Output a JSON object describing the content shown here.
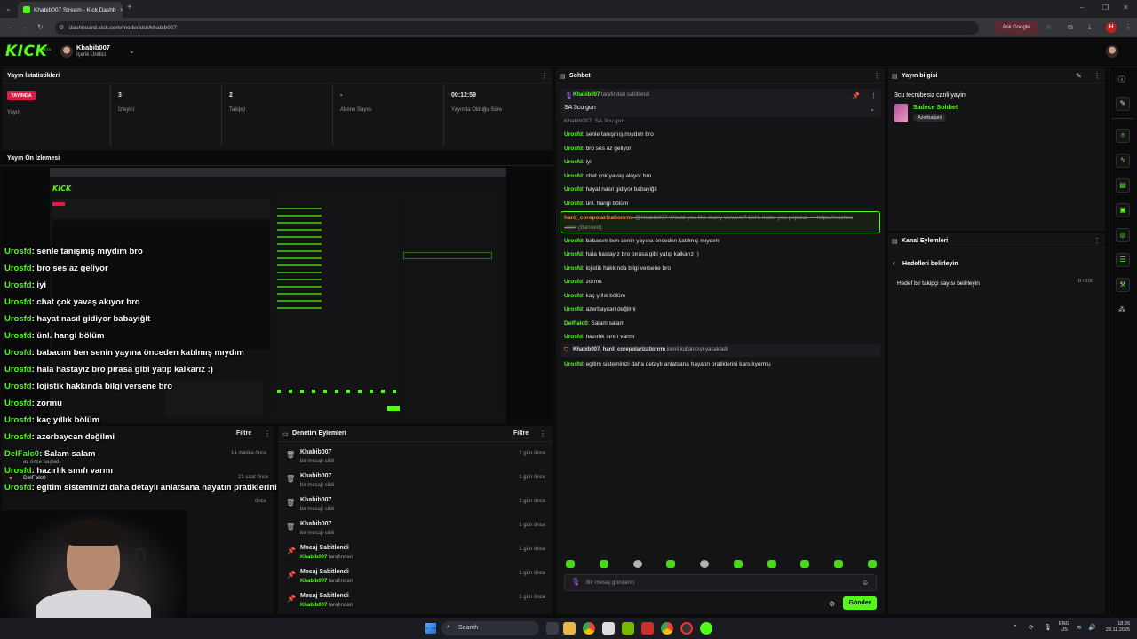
{
  "browser": {
    "tab_title": "Khabib007 Stream - Kick Dashb",
    "url": "dashboard.kick.com/moderator/khabib007",
    "ask_google": "Ask Google",
    "profile_letter": "H"
  },
  "header": {
    "logo": "KICK",
    "logo_badge": "BETA",
    "username": "Khabib007",
    "role": "İçerik Üretici"
  },
  "stats": {
    "title": "Yayın İstatistikleri",
    "live_badge": "YAYINDA",
    "items": [
      {
        "value": "",
        "label": "Yayın"
      },
      {
        "value": "3",
        "label": "İzleyici"
      },
      {
        "value": "2",
        "label": "Takipçi"
      },
      {
        "value": "-",
        "label": "Abone Sayısı"
      },
      {
        "value": "00:12:59",
        "label": "Yayında Olduğu Süre"
      }
    ]
  },
  "preview": {
    "title": "Yayın Ön İzlemesi",
    "overlay_chat": [
      {
        "user": "Urosfd",
        "msg": ": senle tanışmış mıydım bro"
      },
      {
        "user": "Urosfd",
        "msg": ": bro ses az geliyor"
      },
      {
        "user": "Urosfd",
        "msg": ": iyi"
      },
      {
        "user": "Urosfd",
        "msg": ": chat çok yavaş akıyor bro"
      },
      {
        "user": "Urosfd",
        "msg": ": hayat nasıl gidiyor babayiğit"
      },
      {
        "user": "Urosfd",
        "msg": ": ünl. hangi bölüm"
      },
      {
        "user": "Urosfd",
        "msg": ": babacım ben senin yayına önceden katılmış mıydım"
      },
      {
        "user": "Urosfd",
        "msg": ": hala hastayız bro pırasa gibi yatıp kalkarız :)"
      },
      {
        "user": "Urosfd",
        "msg": ": lojistik hakkında bilgi versene bro"
      },
      {
        "user": "Urosfd",
        "msg": ": zormu"
      },
      {
        "user": "Urosfd",
        "msg": ": kaç yıllık bölüm"
      },
      {
        "user": "Urosfd",
        "msg": ": azerbaycan değilmi"
      },
      {
        "user": "DelFalc0",
        "msg": ": Salam salam"
      },
      {
        "user": "Urosfd",
        "msg": ": hazırlık sınıfı varmı"
      },
      {
        "user": "Urosfd",
        "msg": ": egitim sisteminizi daha detaylı anlatsana hayatın pratiklerini karsılıyormu"
      }
    ]
  },
  "left_lower": {
    "filter": "Filtre",
    "row1_time": "14 dakika önce",
    "row1_sub": "az önce başladı",
    "row2_time": "21 saat önce",
    "row2_user": "DelFalc0",
    "row3_time": "önce"
  },
  "modlog": {
    "title": "Denetim Eylemleri",
    "filter": "Filtre",
    "rows": [
      {
        "title": "Khabib007",
        "sub": "bir mesajı sildi",
        "sub_green": "",
        "time": "1 gün önce",
        "icon": "trash-icon"
      },
      {
        "title": "Khabib007",
        "sub": "bir mesajı sildi",
        "sub_green": "",
        "time": "1 gün önce",
        "icon": "trash-icon"
      },
      {
        "title": "Khabib007",
        "sub": "bir mesajı sildi",
        "sub_green": "",
        "time": "1 gün önce",
        "icon": "trash-icon"
      },
      {
        "title": "Khabib007",
        "sub": "bir mesajı sildi",
        "sub_green": "",
        "time": "1 gün önce",
        "icon": "trash-icon"
      },
      {
        "title": "Mesaj Sabitlendi",
        "sub": " tarafından",
        "sub_green": "Khabib007",
        "time": "1 gün önce",
        "icon": "pin-icon"
      },
      {
        "title": "Mesaj Sabitlendi",
        "sub": " tarafından",
        "sub_green": "Khabib007",
        "time": "1 gün önce",
        "icon": "pin-icon"
      },
      {
        "title": "Mesaj Sabitlendi",
        "sub": " tarafından",
        "sub_green": "Khabib007",
        "time": "1 gün önce",
        "icon": "pin-icon"
      }
    ]
  },
  "chat": {
    "title": "Sohbet",
    "pinned_by_user": "Khabib007",
    "pinned_by_text": " tarafından sabitlendi",
    "pinned_msg": "SA 3cu gun",
    "partial_top": "Khabib007: SA 3cu gun",
    "messages": [
      {
        "user": "Urosfd",
        "msg": ": senle tanışmış mıydım bro"
      },
      {
        "user": "Urosfd",
        "msg": ": bro ses az geliyor"
      },
      {
        "user": "Urosfd",
        "msg": ": iyi"
      },
      {
        "user": "Urosfd",
        "msg": ": chat çok yavaş akıyor bro"
      },
      {
        "user": "Urosfd",
        "msg": ": hayat nasıl gidiyor babayiğit"
      },
      {
        "user": "Urosfd",
        "msg": ": ünl. hangi bölüm"
      }
    ],
    "banned": {
      "user": "hard_corepolarizationrm",
      "msg": ": @khabib007 Would you like many viewers? Let's make you popular — https://nezhna",
      "msg2": ".com",
      "tag": "(Banned)"
    },
    "messages2": [
      {
        "user": "Urosfd",
        "msg": ": babacım ben senin yayına önceden katılmış mıydım"
      },
      {
        "user": "Urosfd",
        "msg": ": hala hastayız bro pırasa gibi yatıp kalkarız :)"
      },
      {
        "user": "Urosfd",
        "msg": ": lojistik hakkında bilgi versene bro"
      },
      {
        "user": "Urosfd",
        "msg": ": zormu"
      },
      {
        "user": "Urosfd",
        "msg": ": kaç yıllık bölüm"
      },
      {
        "user": "Urosfd",
        "msg": ": azerbaycan değilmi"
      },
      {
        "user": "DelFalc0",
        "msg": ": Salam salam"
      },
      {
        "user": "Urosfd",
        "msg": ": hazırlık sınıfı varmı"
      }
    ],
    "ban_notice": {
      "user1": "Khabib007",
      "sep": ", ",
      "user2": "hard_corepolarizationrm",
      "text": " isimli kullanıcıyı yasakladı"
    },
    "last": {
      "user": "Urosfd",
      "msg": ": egitim sisteminizi daha detaylı anlatsana hayatın pratiklerini karsılıyormu"
    },
    "input_placeholder": "Bir mesaj gönderin",
    "send": "Gönder"
  },
  "info": {
    "title": "Yayın bilgisi",
    "stream_title": "3cu tecrubesiz canli yayin",
    "category": "Sadece Sohbet",
    "tag": "Azerbaijani"
  },
  "channel_actions": {
    "title": "Kanal Eylemleri",
    "back_label": "Hedefleri belirleyin",
    "goal_label": "Hedef bir takipçi sayısı belirleyin",
    "goal_current": "0",
    "goal_sep": " / ",
    "goal_max": "100"
  },
  "taskbar": {
    "search": "Search",
    "lang1": "ENG",
    "lang2": "US",
    "time": "18:26",
    "date": "23.11.2025"
  },
  "colors": {
    "accent": "#53fc18",
    "panel": "#141416",
    "bg": "#0b0b0c"
  }
}
